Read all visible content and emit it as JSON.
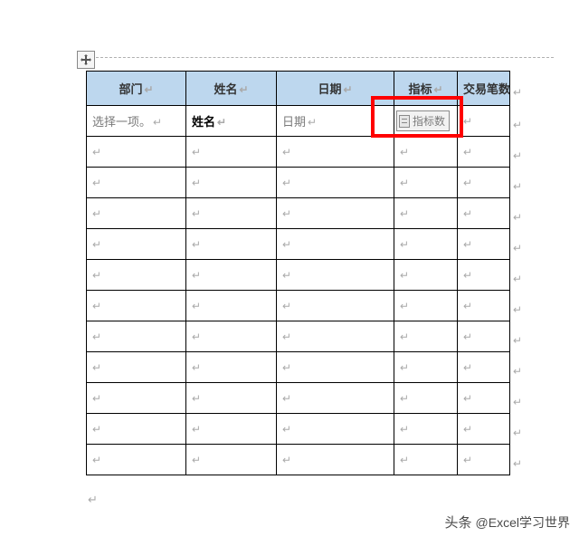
{
  "headers": {
    "c0": "部门",
    "c1": "姓名",
    "c2": "日期",
    "c3": "指标",
    "c4": "交易笔数"
  },
  "row1": {
    "dept_placeholder": "选择一项。",
    "name_placeholder": "姓名",
    "date_placeholder": "日期",
    "indicator_placeholder": "指标数"
  },
  "marks": {
    "para": "↵",
    "header_para": "↵"
  },
  "attribution": {
    "prefix": "头条",
    "handle": "@Excel学习世界"
  },
  "icons": {
    "move_handle": "move-icon",
    "cc_grip": "content-control-grip-icon"
  }
}
